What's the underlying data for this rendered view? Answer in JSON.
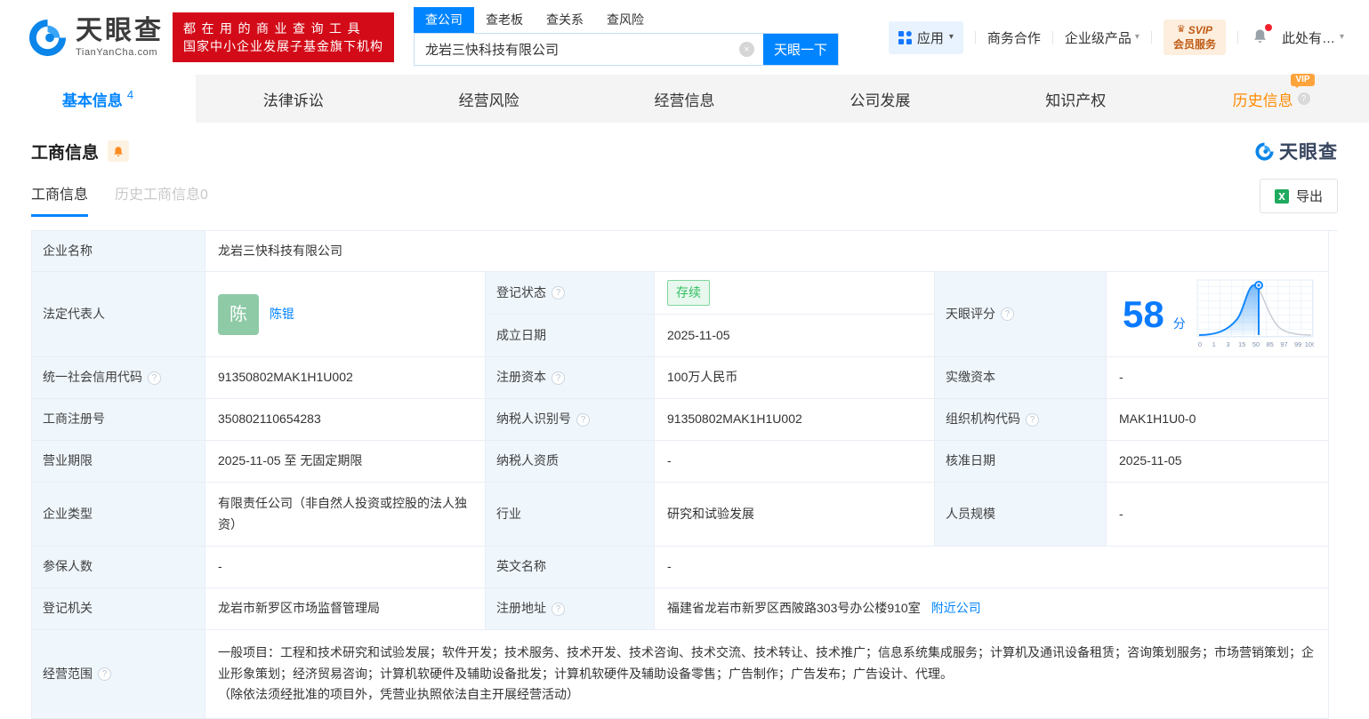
{
  "colors": {
    "brand_blue": "#0084ff",
    "banner_red": "#d30b18",
    "status_green": "#30bf62",
    "vip_orange": "#ff8a00"
  },
  "header": {
    "logo": {
      "brand": "天眼查",
      "domain": "TianYanCha.com"
    },
    "slogan": {
      "line1": "都在用的商业查询工具",
      "line2": "国家中小企业发展子基金旗下机构"
    },
    "search": {
      "tabs": [
        {
          "label": "查公司"
        },
        {
          "label": "查老板"
        },
        {
          "label": "查关系"
        },
        {
          "label": "查风险"
        }
      ],
      "value": "龙岩三快科技有限公司",
      "button": "天眼一下"
    },
    "nav": {
      "apps": "应用",
      "items": [
        "商务合作",
        "企业级产品"
      ],
      "svip_line1": "SVIP",
      "svip_line2": "会员服务",
      "user": "此处有…"
    }
  },
  "tabbar": {
    "tabs": [
      {
        "label": "基本信息",
        "count": "4"
      },
      {
        "label": "法律诉讼"
      },
      {
        "label": "经营风险"
      },
      {
        "label": "经营信息"
      },
      {
        "label": "公司发展"
      },
      {
        "label": "知识产权"
      },
      {
        "label": "历史信息",
        "vip": "VIP"
      }
    ]
  },
  "section": {
    "title": "工商信息",
    "watermark": "天眼查",
    "subtabs": [
      {
        "label": "工商信息"
      },
      {
        "label": "历史工商信息0"
      }
    ],
    "export_label": "导出"
  },
  "score": {
    "value": "58",
    "unit": "分",
    "axis": [
      "0",
      "1",
      "3",
      "15",
      "50",
      "85",
      "97",
      "99",
      "100"
    ]
  },
  "fields": {
    "company_name": {
      "label": "企业名称",
      "value": "龙岩三快科技有限公司"
    },
    "legal_rep": {
      "label": "法定代表人",
      "avatar": "陈",
      "name": "陈锟"
    },
    "reg_status": {
      "label": "登记状态",
      "value": "存续"
    },
    "est_date": {
      "label": "成立日期",
      "value": "2025-11-05"
    },
    "score_label": {
      "label": "天眼评分"
    },
    "credit_code": {
      "label": "统一社会信用代码",
      "value": "91350802MAK1H1U002"
    },
    "reg_capital": {
      "label": "注册资本",
      "value": "100万人民币"
    },
    "paid_capital": {
      "label": "实缴资本",
      "value": "-"
    },
    "reg_number": {
      "label": "工商注册号",
      "value": "350802110654283"
    },
    "taxpayer_id": {
      "label": "纳税人识别号",
      "value": "91350802MAK1H1U002"
    },
    "org_code": {
      "label": "组织机构代码",
      "value": "MAK1H1U0-0"
    },
    "biz_term": {
      "label": "营业期限",
      "value": "2025-11-05 至 无固定期限"
    },
    "taxpayer_quals": {
      "label": "纳税人资质",
      "value": "-"
    },
    "approval_date": {
      "label": "核准日期",
      "value": "2025-11-05"
    },
    "company_type": {
      "label": "企业类型",
      "value": "有限责任公司（非自然人投资或控股的法人独资）"
    },
    "industry": {
      "label": "行业",
      "value": "研究和试验发展"
    },
    "staff_size": {
      "label": "人员规模",
      "value": "-"
    },
    "insured_count": {
      "label": "参保人数",
      "value": "-"
    },
    "english_name": {
      "label": "英文名称",
      "value": "-"
    },
    "reg_authority": {
      "label": "登记机关",
      "value": "龙岩市新罗区市场监督管理局"
    },
    "reg_address": {
      "label": "注册地址",
      "value": "福建省龙岩市新罗区西陂路303号办公楼910室",
      "link": "附近公司"
    },
    "business_scope": {
      "label": "经营范围",
      "value": "一般项目：工程和技术研究和试验发展；软件开发；技术服务、技术开发、技术咨询、技术交流、技术转让、技术推广；信息系统集成服务；计算机及通讯设备租赁；咨询策划服务；市场营销策划；企业形象策划；经济贸易咨询；计算机软硬件及辅助设备批发；计算机软硬件及辅助设备零售；广告制作；广告发布；广告设计、代理。\n（除依法须经批准的项目外，凭营业执照依法自主开展经营活动）"
    }
  }
}
